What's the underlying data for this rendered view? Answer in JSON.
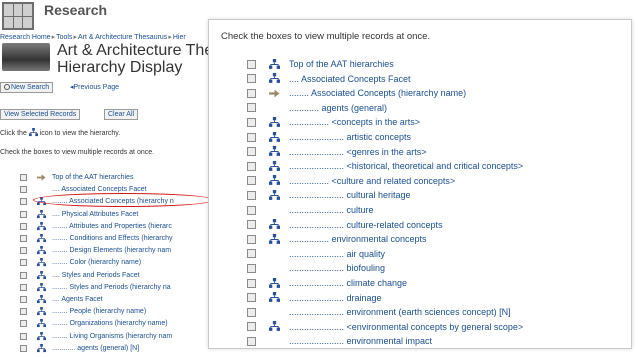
{
  "site": {
    "name": "Research"
  },
  "breadcrumb": [
    "Research Home",
    "Tools",
    "Art & Architecture Thesaurus",
    "Hier"
  ],
  "page": {
    "title_line1": "Art & Architecture Thesa",
    "title_line2": "Hierarchy Display"
  },
  "nav": {
    "new_search": "New Search",
    "previous_page": "Previous Page"
  },
  "buttons": {
    "view_selected": "View Selected Records",
    "clear_all": "Clear All"
  },
  "instructions": {
    "icon_prefix": "Click the",
    "icon_suffix": "icon to view the hierarchy.",
    "checkbox": "Check the boxes to view multiple records at once."
  },
  "background_rows": [
    {
      "icon": "arrow-icon",
      "text": "Top of the AAT hierarchies"
    },
    {
      "icon": "none",
      "text": ".... Associated Concepts Facet"
    },
    {
      "icon": "hierarchy-icon",
      "text": "........ Associated Concepts (hierarchy n"
    },
    {
      "icon": "hierarchy-icon",
      "text": ".... Physical Attributes Facet"
    },
    {
      "icon": "hierarchy-icon",
      "text": "........ Attributes and Properties (hierarc"
    },
    {
      "icon": "hierarchy-icon",
      "text": "........ Conditions and Effects (hierarchy"
    },
    {
      "icon": "hierarchy-icon",
      "text": "........ Design Elements (hierarchy nam"
    },
    {
      "icon": "hierarchy-icon",
      "text": "........ Color (hierarchy name)"
    },
    {
      "icon": "hierarchy-icon",
      "text": ".... Styles and Periods Facet"
    },
    {
      "icon": "hierarchy-icon",
      "text": "........ Styles and Periods (hierarchy na"
    },
    {
      "icon": "hierarchy-icon",
      "text": ".... Agents Facet"
    },
    {
      "icon": "hierarchy-icon",
      "text": "........ People (hierarchy name)"
    },
    {
      "icon": "hierarchy-icon",
      "text": "........ Organizations (hierarchy name)"
    },
    {
      "icon": "hierarchy-icon",
      "text": "........ Living Organisms (hierarchy nam"
    },
    {
      "icon": "hierarchy-icon",
      "text": "............ agents (general) [N]"
    }
  ],
  "popup": {
    "instruction": "Check the boxes to view multiple records at once.",
    "rows": [
      {
        "icon": "hierarchy-icon",
        "text": "Top of the AAT hierarchies"
      },
      {
        "icon": "hierarchy-icon",
        "text": ".... Associated Concepts Facet"
      },
      {
        "icon": "arrow-icon",
        "text": "........ Associated Concepts (hierarchy name)"
      },
      {
        "icon": "none",
        "text": "............ agents (general)"
      },
      {
        "icon": "hierarchy-icon",
        "text": "................ <concepts in the arts>"
      },
      {
        "icon": "hierarchy-icon",
        "text": "...................... artistic concepts"
      },
      {
        "icon": "hierarchy-icon",
        "text": "...................... <genres in the arts>"
      },
      {
        "icon": "hierarchy-icon",
        "text": "...................... <historical, theoretical and critical concepts>"
      },
      {
        "icon": "hierarchy-icon",
        "text": "................ <culture and related concepts>"
      },
      {
        "icon": "hierarchy-icon",
        "text": "...................... cultural heritage"
      },
      {
        "icon": "none",
        "text": "...................... culture"
      },
      {
        "icon": "hierarchy-icon",
        "text": "...................... culture-related concepts"
      },
      {
        "icon": "hierarchy-icon",
        "text": "................ environmental concepts"
      },
      {
        "icon": "none",
        "text": "...................... air quality"
      },
      {
        "icon": "none",
        "text": "...................... biofouling"
      },
      {
        "icon": "hierarchy-icon",
        "text": "...................... climate change"
      },
      {
        "icon": "hierarchy-icon",
        "text": "...................... drainage"
      },
      {
        "icon": "none",
        "text": "...................... environment (earth sciences concept) [N]"
      },
      {
        "icon": "hierarchy-icon",
        "text": "...................... <environmental concepts by general scope>"
      },
      {
        "icon": "none",
        "text": "...................... environmental impact"
      }
    ]
  },
  "colors": {
    "link": "#1b4f8f",
    "hierarchy_icon": "#2a4f9a",
    "arrow_icon": "#9a8a6a",
    "highlight": "#d01818"
  }
}
